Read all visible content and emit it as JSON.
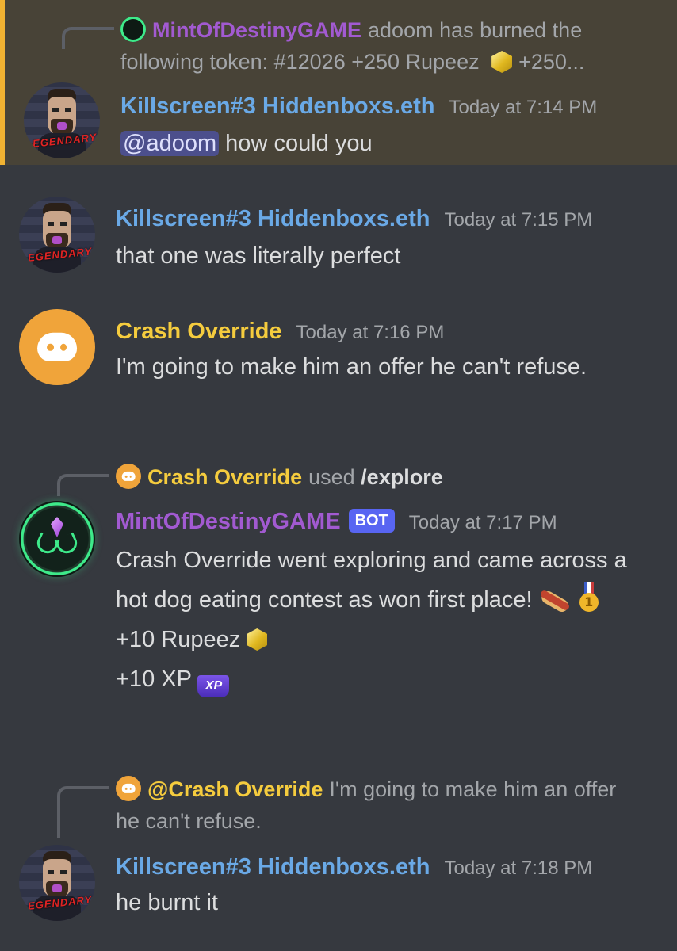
{
  "messages": [
    {
      "reply": {
        "author": "MintOfDestinyGAME",
        "text": "adoom has burned the following token: #12026 +250 Rupeez",
        "text_after": "+250..."
      },
      "author": "Killscreen#3 Hiddenboxs.eth",
      "timestamp": "Today at 7:14 PM",
      "mention": "@adoom",
      "text": " how could you"
    },
    {
      "author": "Killscreen#3 Hiddenboxs.eth",
      "timestamp": "Today at 7:15 PM",
      "text": "that one was literally perfect"
    },
    {
      "author": "Crash Override",
      "timestamp": "Today at 7:16 PM",
      "text": "I'm going to make him an offer he can't refuse."
    },
    {
      "interaction": {
        "user": "Crash Override",
        "used": "used",
        "command": "/explore"
      },
      "author": "MintOfDestinyGAME",
      "bot_tag": "BOT",
      "timestamp": "Today at 7:17 PM",
      "text": "Crash Override went exploring and came across a hot dog eating contest as won first place!",
      "rupeez_line": "+10 Rupeez",
      "xp_line": "+10 XP",
      "xp_icon_text": "XP"
    },
    {
      "reply": {
        "author": "@Crash Override",
        "text": "I'm going to make him an offer he can't refuse."
      },
      "author": "Killscreen#3 Hiddenboxs.eth",
      "timestamp": "Today at 7:18 PM",
      "text": "he burnt it"
    }
  ],
  "avatar_badge": "LEGENDARY",
  "colors": {
    "background": "#36393f",
    "highlight_bg": "#484337",
    "highlight_bar": "#f0b232",
    "username_blue": "#6aa9e6",
    "username_yellow": "#f5cc3e",
    "username_purple": "#a25ad1",
    "bot_tag": "#5865f2",
    "mention_bg": "#4c4f8c"
  },
  "icons": [
    "discord-logo-icon",
    "rupeez-icon",
    "hotdog-icon",
    "first-place-medal-icon",
    "xp-icon"
  ]
}
